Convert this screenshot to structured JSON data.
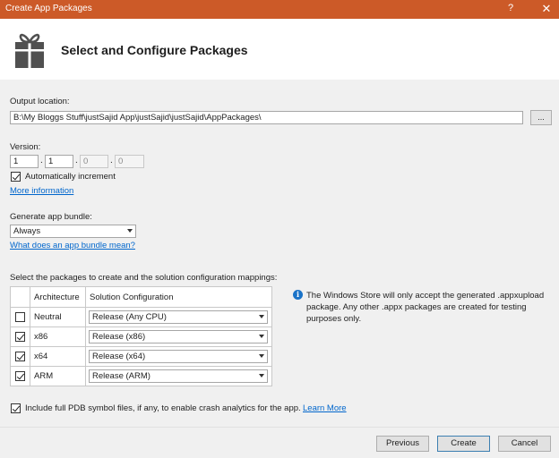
{
  "window": {
    "title": "Create App Packages",
    "help_glyph": "?",
    "close_glyph": "✕"
  },
  "header": {
    "heading": "Select and Configure Packages",
    "icon": "package-icon"
  },
  "output": {
    "label": "Output location:",
    "value": "B:\\My Bloggs Stuff\\justSajid App\\justSajid\\justSajid\\AppPackages\\",
    "browse_label": "..."
  },
  "version": {
    "label": "Version:",
    "major": "1",
    "minor": "1",
    "build": "0",
    "revision": "0",
    "separator": ".",
    "auto_increment_label": "Automatically increment",
    "auto_increment_checked": true,
    "more_info_link": "More information"
  },
  "bundle": {
    "label": "Generate app bundle:",
    "selected": "Always",
    "help_link": "What does an app bundle mean?"
  },
  "packages": {
    "label": "Select the packages to create and the solution configuration mappings:",
    "columns": [
      "",
      "Architecture",
      "Solution Configuration"
    ],
    "rows": [
      {
        "checked": false,
        "architecture": "Neutral",
        "configuration": "Release (Any CPU)"
      },
      {
        "checked": true,
        "architecture": "x86",
        "configuration": "Release (x86)"
      },
      {
        "checked": true,
        "architecture": "x64",
        "configuration": "Release (x64)"
      },
      {
        "checked": true,
        "architecture": "ARM",
        "configuration": "Release (ARM)"
      }
    ],
    "info_text": "The Windows Store will only accept the generated .appxupload package. Any other .appx packages are created for testing purposes only."
  },
  "pdb": {
    "checked": true,
    "label": "Include full PDB symbol files, if any, to enable crash analytics for the app.",
    "link": "Learn More"
  },
  "buttons": {
    "previous": "Previous",
    "create": "Create",
    "cancel": "Cancel"
  },
  "colors": {
    "titlebar": "#cc5a28",
    "link": "#0066cc",
    "info": "#1a73c8"
  }
}
